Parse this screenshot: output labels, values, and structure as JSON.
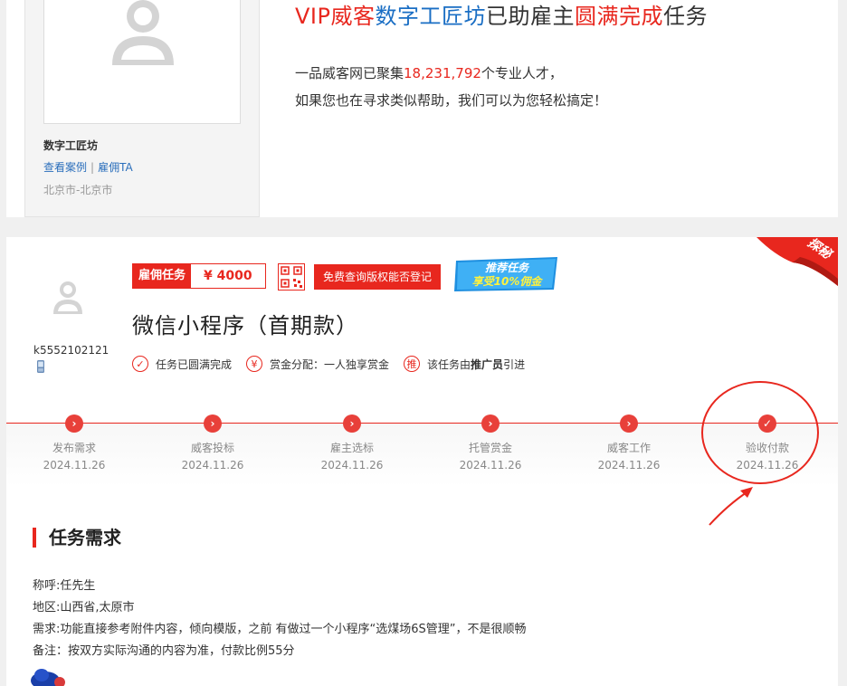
{
  "provider": {
    "name": "数字工匠坊",
    "link_cases": "查看案例",
    "link_hire": "雇佣TA",
    "separator": "|",
    "location": "北京市-北京市"
  },
  "headline": {
    "part1": "VIP威客",
    "part2": "数字工匠坊",
    "part3": "已助雇主",
    "part4": "圆满完成",
    "part5": "任务"
  },
  "subline": {
    "prefix": "一品威客网已聚集",
    "count": "18,231,792",
    "suffix": "个专业人才，",
    "line2": "如果您也在寻求类似帮助，我们可以为您轻松搞定！"
  },
  "corner_ribbon": "探秘",
  "employer": {
    "id": "k5552102121"
  },
  "task": {
    "badge_label": "雇佣任务",
    "amount": "¥ 4000",
    "copyright_button": "免费查询版权能否登记",
    "promo_line1": "推荐任务",
    "promo_line2": "享受10%佣金",
    "title": "微信小程序（首期款）",
    "status_completed": "任务已圆满完成",
    "status_reward": "赏金分配：一人独享赏金",
    "status_promo_icon": "推",
    "status_promo_prefix": "该任务由",
    "status_promo_bold": "推广员",
    "status_promo_suffix": "引进"
  },
  "timeline": [
    {
      "label": "发布需求",
      "date": "2024.11.26",
      "icon": "chevron-right-icon"
    },
    {
      "label": "威客投标",
      "date": "2024.11.26",
      "icon": "chevron-right-icon"
    },
    {
      "label": "雇主选标",
      "date": "2024.11.26",
      "icon": "chevron-right-icon"
    },
    {
      "label": "托管赏金",
      "date": "2024.11.26",
      "icon": "chevron-right-icon"
    },
    {
      "label": "威客工作",
      "date": "2024.11.26",
      "icon": "chevron-right-icon"
    },
    {
      "label": "验收付款",
      "date": "2024.11.26",
      "icon": "check-icon"
    }
  ],
  "requirements": {
    "section_title": "任务需求",
    "contact": "称呼:任先生",
    "region": "地区:山西省,太原市",
    "need": "需求:功能直接参考附件内容，倾向模版，之前 有做过一个小程序“选煤场6S管理”，不是很顺畅",
    "note": "备注：按双方实际沟通的内容为准，付款比例55分"
  },
  "colors": {
    "accent_red": "#e8271e",
    "link_blue": "#2a6ebb",
    "headline_blue": "#1a6ec4"
  }
}
